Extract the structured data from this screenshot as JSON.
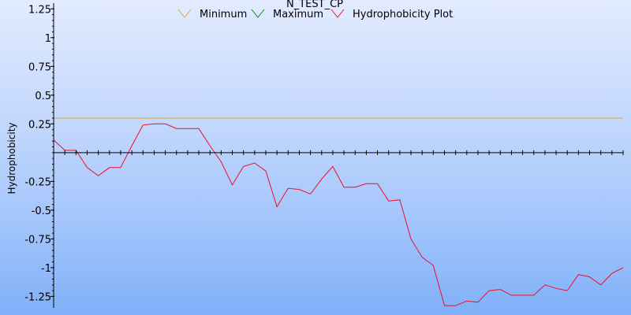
{
  "chart_data": {
    "type": "line",
    "title": "N_TEST_CP",
    "xlabel": "",
    "ylabel": "Hydrophobicity",
    "ylim": [
      -1.35,
      1.3
    ],
    "xlim": [
      0,
      51
    ],
    "yticks": [
      1.25,
      1,
      0.75,
      0.5,
      0.25,
      -0.25,
      -0.5,
      -0.75,
      -1,
      -1.25
    ],
    "ytick_labels": [
      "1.25",
      "1",
      "0.75",
      "0.5",
      "0.25",
      "-0.25",
      "-0.5",
      "-0.75",
      "-1",
      "-1.25"
    ],
    "legend": {
      "placement": "top-center"
    },
    "grid": false,
    "series": [
      {
        "name": "Minimum",
        "color": "#e8a33c",
        "x": [
          0,
          51
        ],
        "y": [
          0.3,
          0.3
        ]
      },
      {
        "name": "Maximum",
        "color": "#0a8a0a",
        "x": [],
        "y": []
      },
      {
        "name": "Hydrophobicity Plot",
        "color": "#e8102a",
        "x": [
          0,
          1,
          2,
          3,
          4,
          5,
          6,
          7,
          8,
          9,
          10,
          11,
          12,
          13,
          14,
          15,
          16,
          17,
          18,
          19,
          20,
          21,
          22,
          23,
          24,
          25,
          26,
          27,
          28,
          29,
          30,
          31,
          32,
          33,
          34,
          35,
          36,
          37,
          38,
          39,
          40,
          41,
          42,
          43,
          44,
          45,
          46,
          47,
          48,
          49,
          50,
          51
        ],
        "y": [
          0.11,
          0.02,
          0.02,
          -0.13,
          -0.2,
          -0.13,
          -0.13,
          0.06,
          0.24,
          0.25,
          0.25,
          0.21,
          0.21,
          0.21,
          0.06,
          -0.08,
          -0.28,
          -0.12,
          -0.09,
          -0.16,
          -0.47,
          -0.31,
          -0.32,
          -0.36,
          -0.23,
          -0.12,
          -0.3,
          -0.3,
          -0.27,
          -0.27,
          -0.42,
          -0.41,
          -0.75,
          -0.91,
          -0.98,
          -1.33,
          -1.33,
          -1.29,
          -1.3,
          -1.2,
          -1.19,
          -1.24,
          -1.24,
          -1.24,
          -1.15,
          -1.18,
          -1.2,
          -1.06,
          -1.08,
          -1.15,
          -1.05,
          -1.0
        ]
      }
    ]
  }
}
